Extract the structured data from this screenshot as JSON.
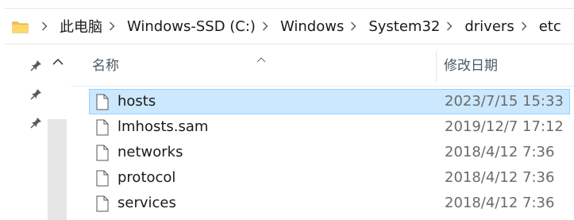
{
  "address_bar": {
    "breadcrumbs": [
      "此电脑",
      "Windows-SSD (C:)",
      "Windows",
      "System32",
      "drivers",
      "etc"
    ]
  },
  "columns": {
    "name_label": "名称",
    "date_label": "修改日期"
  },
  "files": [
    {
      "name": "hosts",
      "modified": "2023/7/15 15:33",
      "selected": true
    },
    {
      "name": "lmhosts.sam",
      "modified": "2019/12/7 17:12",
      "selected": false
    },
    {
      "name": "networks",
      "modified": "2018/4/12 7:36",
      "selected": false
    },
    {
      "name": "protocol",
      "modified": "2018/4/12 7:36",
      "selected": false
    },
    {
      "name": "services",
      "modified": "2018/4/12 7:36",
      "selected": false
    }
  ],
  "quick_access": {
    "icons": [
      "pin-icon",
      "pin-icon",
      "pin-icon",
      "chevron-up-icon"
    ]
  },
  "colors": {
    "selection_background": "#cce8ff",
    "selection_border": "#99d1ff",
    "folder": "#f8c146"
  }
}
